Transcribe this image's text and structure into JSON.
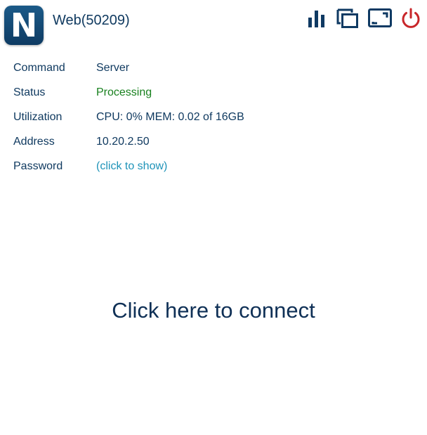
{
  "app": {
    "logo_letter": "N",
    "title": "Web(50209)"
  },
  "toolbar": {
    "icons": [
      {
        "name": "stats-icon",
        "color": "#0f3a63"
      },
      {
        "name": "clone-icon",
        "color": "#0f3a63"
      },
      {
        "name": "fullscreen-icon",
        "color": "#0f3a63"
      },
      {
        "name": "power-icon",
        "color": "#c8262a"
      }
    ]
  },
  "details": {
    "command": {
      "label": "Command",
      "value": "Server"
    },
    "status": {
      "label": "Status",
      "value": "Processing",
      "color": "#19811f"
    },
    "utilization": {
      "label": "Utilization",
      "value": "CPU: 0% MEM: 0.02 of 16GB"
    },
    "address": {
      "label": "Address",
      "value": "10.20.2.50"
    },
    "password": {
      "label": "Password",
      "value": "(click to show)",
      "color": "#1e93b8"
    }
  },
  "connect": {
    "label": "Click here to connect"
  }
}
